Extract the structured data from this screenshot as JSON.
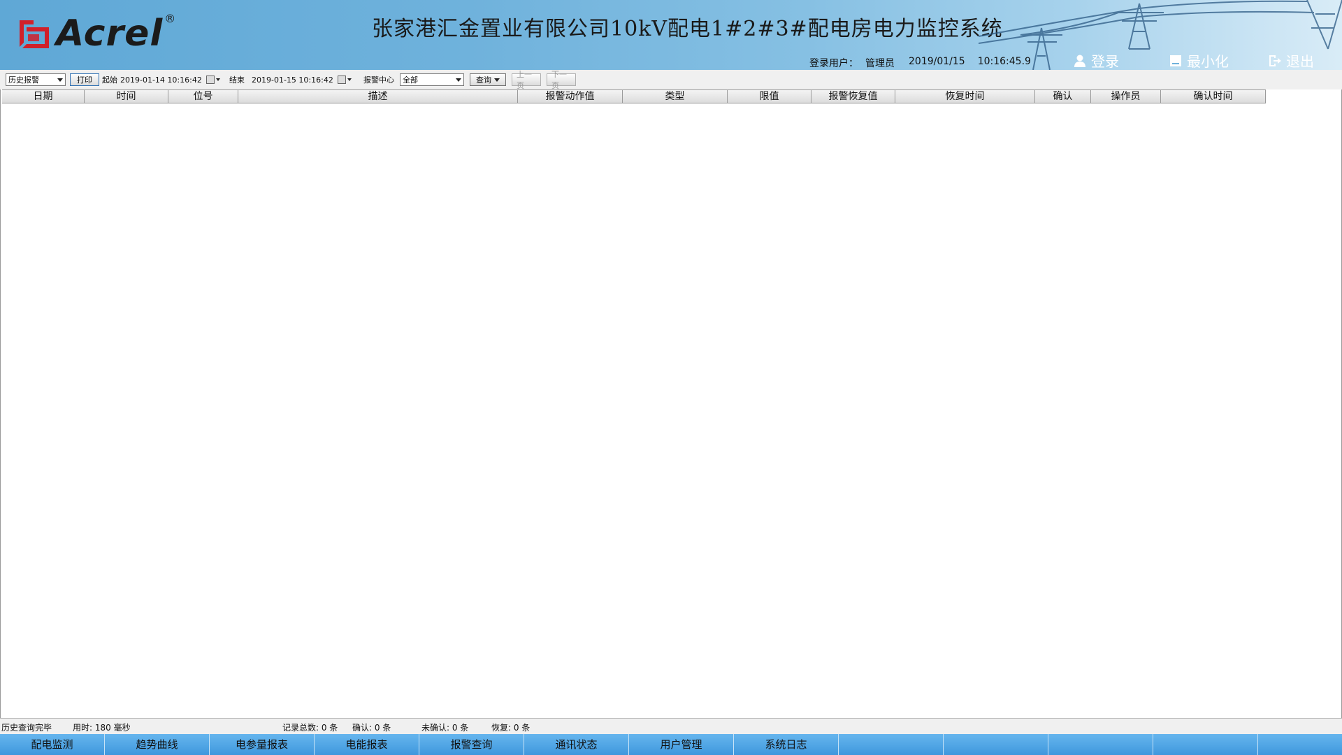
{
  "header": {
    "logo_text": "Acrel",
    "logo_reg": "®",
    "title": "张家港汇金置业有限公司10kV配电1#2#3#配电房电力监控系统",
    "user_label": "登录用户：",
    "user_name": "管理员",
    "date": "2019/01/15",
    "time": "10:16:45.9",
    "login_label": "登录",
    "minimize_label": "最小化",
    "exit_label": "退出"
  },
  "toolbar": {
    "mode_select": "历史报警",
    "print_label": "打印",
    "start_label": "起始",
    "start_value": "2019-01-14  10:16:42",
    "end_label": "结束",
    "end_value": "2019-01-15  10:16:42",
    "center_label": "报警中心",
    "center_select": "全部",
    "query_label": "查询",
    "prev_label": "上一页",
    "next_label": "下一页"
  },
  "table": {
    "columns": [
      "日期",
      "时间",
      "位号",
      "描述",
      "报警动作值",
      "类型",
      "限值",
      "报警恢复值",
      "恢复时间",
      "确认",
      "操作员",
      "确认时间"
    ]
  },
  "status": {
    "message": "历史查询完毕",
    "elapsed": "用时: 180 毫秒",
    "total": "记录总数: 0 条",
    "confirmed": "确认: 0 条",
    "unconfirmed": "未确认: 0 条",
    "recovered": "恢复: 0 条"
  },
  "nav": {
    "items": [
      "配电监测",
      "趋势曲线",
      "电参量报表",
      "电能报表",
      "报警查询",
      "通讯状态",
      "用户管理",
      "系统日志",
      "",
      "",
      "",
      "",
      ""
    ]
  },
  "colors": {
    "header_blue": "#5fa8d6",
    "nav_blue": "#3f97dd",
    "logo_red": "#d0202a"
  }
}
